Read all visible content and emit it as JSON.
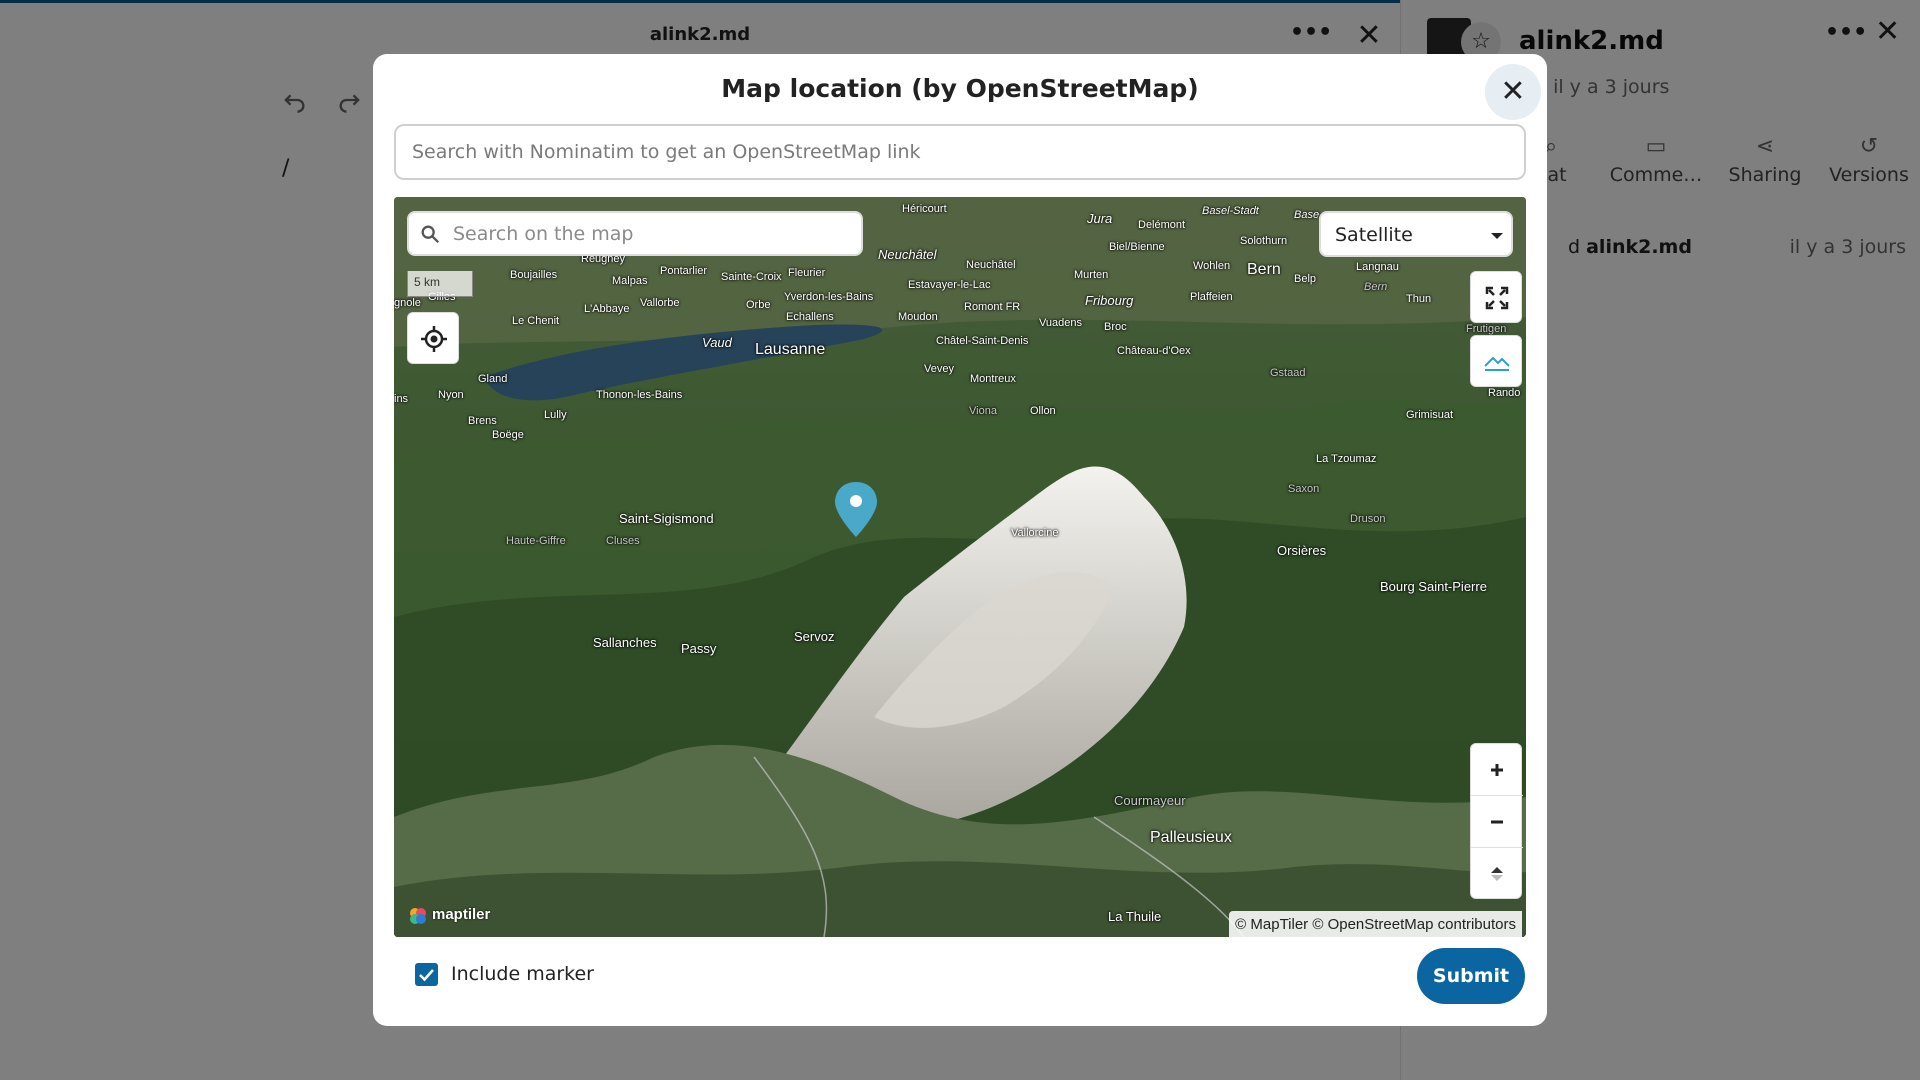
{
  "editor": {
    "title": "alink2.md",
    "more_label": "•••",
    "close_label": "✕",
    "path_slash": "/"
  },
  "sidebar": {
    "title": "alink2.md",
    "more_label": "•••",
    "close_label": "✕",
    "subtitle": ", il y a 3 jours",
    "tabs": [
      {
        "label": "hat",
        "icon": "search-icon"
      },
      {
        "label": "Comme…",
        "icon": "comment-icon"
      },
      {
        "label": "Sharing",
        "icon": "share-icon"
      },
      {
        "label": "Versions",
        "icon": "history-icon"
      }
    ],
    "activity": {
      "prefix": "d",
      "file": "alink2.md",
      "time": "il y a 3 jours"
    }
  },
  "modal": {
    "title": "Map location (by OpenStreetMap)",
    "close_label": "✕",
    "search_placeholder": "Search with Nominatim to get an OpenStreetMap link",
    "map": {
      "search_placeholder": "Search on the map",
      "scale_label": "5 km",
      "style_value": "Satellite",
      "attribution": "© MapTiler © OpenStreetMap contributors",
      "logo_text": "maptiler",
      "zoom_in_label": "+",
      "zoom_out_label": "−",
      "labels": {
        "hericourt": "Héricourt",
        "jura": "Jura",
        "delemont": "Delémont",
        "basel": "Basel-Stadt",
        "base": "Base",
        "solothurn": "Solothurn",
        "bielbienne": "Biel/Bienne",
        "reugney": "Reugney",
        "neuchatel_big": "Neuchâtel",
        "neuchatel_small": "Neuchâtel",
        "murten": "Murten",
        "wohlen": "Wohlen",
        "bern": "Bern",
        "belp": "Belp",
        "langnau": "Langnau",
        "boujailles": "Boujailles",
        "malpas": "Malpas",
        "pontarlier": "Pontarlier",
        "saintecroix": "Sainte-Croix",
        "fleurier": "Fleurier",
        "estavayer": "Estavayer-le-Lac",
        "fribourg": "Fribourg",
        "plaffeien": "Plaffeien",
        "bern_italic": "Bern",
        "thun": "Thun",
        "gnole": "gnole",
        "gilles": "Gilles",
        "vallorbe": "Vallorbe",
        "orbe": "Orbe",
        "yverdon": "Yverdon-les-Bains",
        "labbaye": "L'Abbaye",
        "lechenit": "Le Chenit",
        "echallens": "Echallens",
        "moudon": "Moudon",
        "romont": "Romont FR",
        "vuadens": "Vuadens",
        "broc": "Broc",
        "frutigen": "Frutigen",
        "vaud": "Vaud",
        "lausanne": "Lausanne",
        "chatelstdenis": "Châtel-Saint-Denis",
        "chateaudoex": "Château-d'Oex",
        "gstaad": "Gstaad",
        "gland": "Gland",
        "vevey": "Vevey",
        "montreux": "Montreux",
        "rando": "Rando",
        "ins": "ins",
        "nyon": "Nyon",
        "thonon": "Thonon-les-Bains",
        "lully": "Lully",
        "viona": "Viona",
        "ollon": "Ollon",
        "grimisuat": "Grimisuat",
        "brens": "Brens",
        "boege": "Boëge",
        "latzoumaz": "La Tzoumaz",
        "saxon": "Saxon",
        "saintsigismond": "Saint-Sigismond",
        "hautegiffre": "Haute-Giffre",
        "cluses": "Cluses",
        "vallorcine": "Vallorcine",
        "druson": "Druson",
        "orsieres": "Orsières",
        "bourgstpierre": "Bourg Saint-Pierre",
        "sallanches": "Sallanches",
        "passy": "Passy",
        "servoz": "Servoz",
        "courmayeur": "Courmayeur",
        "palleusieux": "Palleusieux",
        "lathuile": "La Thuile"
      }
    },
    "include_marker_label": "Include marker",
    "include_marker_checked": true,
    "submit_label": "Submit"
  },
  "colors": {
    "accent": "#0b65a1",
    "marker": "#4aa8c8",
    "overlay": "rgba(0,0,0,0.5)"
  }
}
